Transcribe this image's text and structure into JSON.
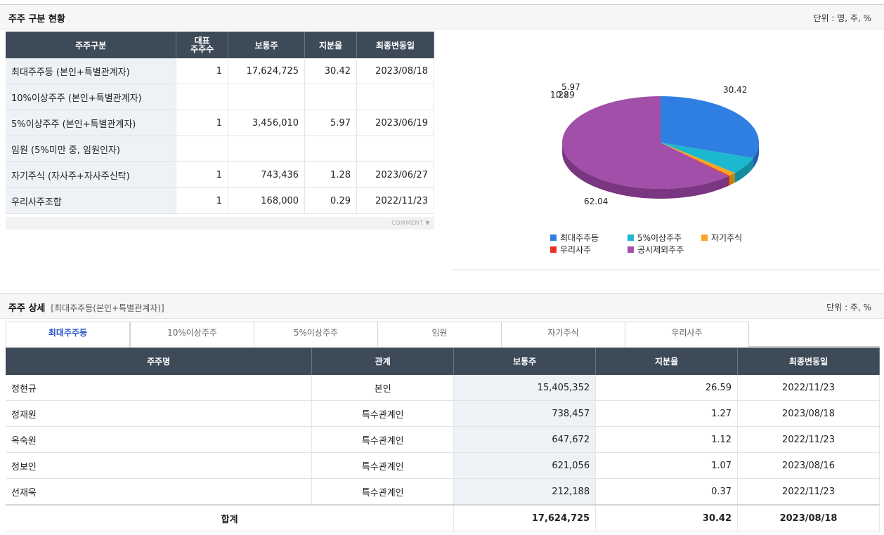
{
  "section1": {
    "title": "주주 구분 현황",
    "unit": "단위 : 명, 주, %"
  },
  "table1": {
    "headers": [
      "주주구분",
      "대표\n주주수",
      "보통주",
      "지분율",
      "최종변동일"
    ],
    "header_rep_1": "대표",
    "header_rep_2": "주주수",
    "rows": [
      {
        "label": "최대주주등 (본인+특별관계자)",
        "count": "1",
        "shares": "17,624,725",
        "ratio": "30.42",
        "date": "2023/08/18"
      },
      {
        "label": "10%이상주주 (본인+특별관계자)",
        "count": "",
        "shares": "",
        "ratio": "",
        "date": ""
      },
      {
        "label": "5%이상주주 (본인+특별관계자)",
        "count": "1",
        "shares": "3,456,010",
        "ratio": "5.97",
        "date": "2023/06/19"
      },
      {
        "label": "임원 (5%미만 중, 임원인자)",
        "count": "",
        "shares": "",
        "ratio": "",
        "date": ""
      },
      {
        "label": "자기주식 (자사주+자사주신탁)",
        "count": "1",
        "shares": "743,436",
        "ratio": "1.28",
        "date": "2023/06/27"
      },
      {
        "label": "우리사주조합",
        "count": "1",
        "shares": "168,000",
        "ratio": "0.29",
        "date": "2022/11/23"
      }
    ],
    "comment": "COMMENT"
  },
  "chart_data": {
    "type": "pie",
    "categories": [
      "최대주주등",
      "5%이상주주",
      "자기주식",
      "우리사주",
      "공시제외주주"
    ],
    "values": [
      30.42,
      5.97,
      1.28,
      0.29,
      62.04
    ],
    "labels": [
      "30.42",
      "5.97",
      "1.28",
      "0.29",
      "62.04"
    ],
    "colors": [
      "#2f7fe3",
      "#1cb8cf",
      "#f5a623",
      "#e8302a",
      "#a24fa9"
    ],
    "side_colors": [
      "#1f5fb0",
      "#148c9f",
      "#c47f14",
      "#b0201c",
      "#7a3680"
    ],
    "legend_placement": "bottom"
  },
  "section2": {
    "title": "주주 상세",
    "subtitle": "[최대주주등(본인+특별관계자)]",
    "unit": "단위 : 주, %"
  },
  "tabs": [
    "최대주주등",
    "10%이상주주",
    "5%이상주주",
    "임원",
    "자기주식",
    "우리사주"
  ],
  "table2": {
    "headers": [
      "주주명",
      "관계",
      "보통주",
      "지분율",
      "최종변동일"
    ],
    "rows": [
      {
        "name": "정현규",
        "rel": "본인",
        "shares": "15,405,352",
        "ratio": "26.59",
        "date": "2022/11/23"
      },
      {
        "name": "정재원",
        "rel": "특수관계인",
        "shares": "738,457",
        "ratio": "1.27",
        "date": "2023/08/18"
      },
      {
        "name": "옥숙원",
        "rel": "특수관계인",
        "shares": "647,672",
        "ratio": "1.12",
        "date": "2022/11/23"
      },
      {
        "name": "정보인",
        "rel": "특수관계인",
        "shares": "621,056",
        "ratio": "1.07",
        "date": "2023/08/16"
      },
      {
        "name": "선재욱",
        "rel": "특수관계인",
        "shares": "212,188",
        "ratio": "0.37",
        "date": "2022/11/23"
      }
    ],
    "total": {
      "label": "합계",
      "shares": "17,624,725",
      "ratio": "30.42",
      "date": "2023/08/18"
    }
  }
}
